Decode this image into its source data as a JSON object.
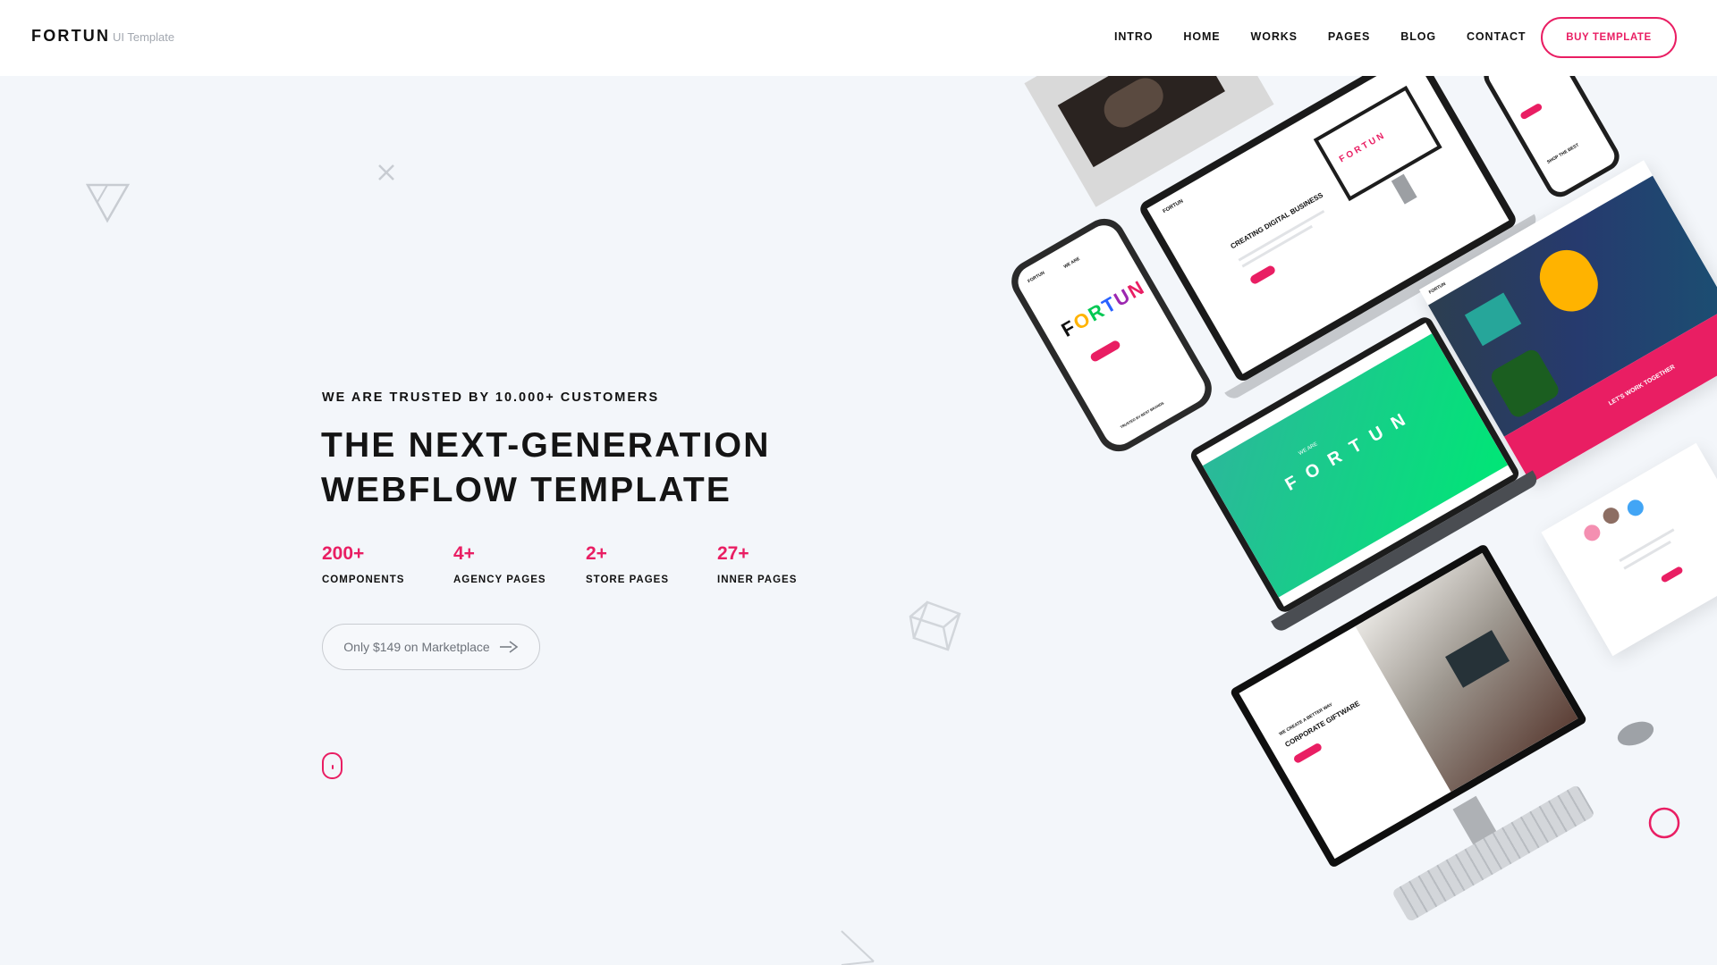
{
  "header": {
    "logo": "FORTUN",
    "logo_sub": "UI Template",
    "nav": [
      "INTRO",
      "HOME",
      "WORKS",
      "PAGES",
      "BLOG",
      "CONTACT"
    ],
    "buy_button": "BUY TEMPLATE"
  },
  "hero": {
    "eyebrow": "WE ARE TRUSTED BY 10.000+ CUSTOMERS",
    "title_line1": "THE NEXT-GENERATION",
    "title_line2": "WEBFLOW TEMPLATE",
    "stats": [
      {
        "value": "200+",
        "label": "COMPONENTS"
      },
      {
        "value": "4+",
        "label": "AGENCY PAGES"
      },
      {
        "value": "2+",
        "label": "STORE PAGES"
      },
      {
        "value": "27+",
        "label": "INNER PAGES"
      }
    ],
    "price_button": "Only $149 on Marketplace"
  },
  "mockups": {
    "phone_brand": "FORTUN",
    "phone_tag": "WE ARE",
    "phone_footer": "TRUSTED BY BEST BRANDS",
    "laptop_top_heading": "CREATING DIGITAL BUSINESS",
    "green_screen_title": "F O R T U N",
    "green_screen_sub": "WE ARE",
    "studio_heading": "CORPORATE GIFTWARE",
    "studio_eyebrow": "WE CREATE A BETTER WAY",
    "banner_text": "LET'S WORK TOGETHER",
    "small_logo": "FORTUN",
    "small_phone_text": "SHOP THE BEST",
    "monitor_logo": "F O R T U N"
  },
  "colors": {
    "accent": "#e91e63",
    "background": "#f3f6fa",
    "text": "#111111",
    "green_start": "#2bb89a",
    "green_end": "#00e676"
  },
  "icons": [
    "close-x-icon",
    "triangle-outline-icon",
    "cube-outline-icon",
    "circle-outline-icon",
    "chevron-icon",
    "scroll-mouse-icon",
    "arrow-right-icon"
  ]
}
